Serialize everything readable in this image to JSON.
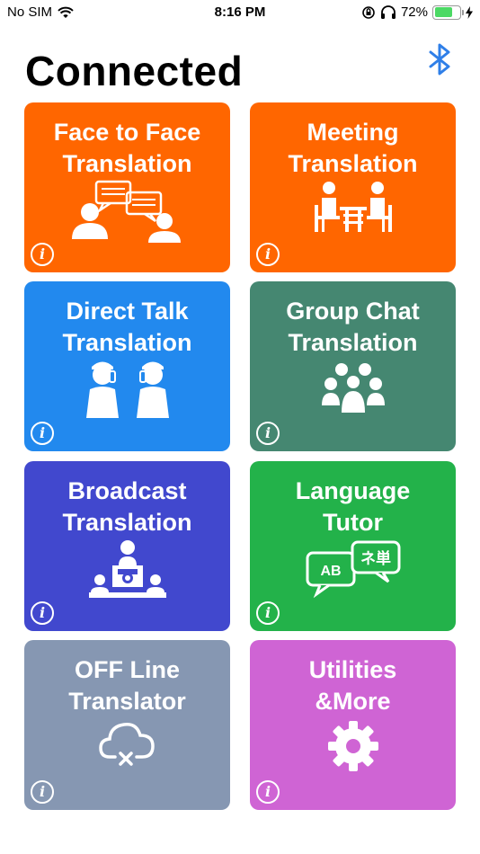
{
  "status_bar": {
    "carrier": "No SIM",
    "time": "8:16 PM",
    "battery_percent": "72%",
    "battery_level": 0.72
  },
  "header": {
    "title": "Connected",
    "bluetooth_icon": "bluetooth-icon"
  },
  "tiles": [
    {
      "id": "face-to-face",
      "line1": "Face to Face",
      "line2": "Translation",
      "color": "#FF6600",
      "icon": "face-to-face-icon"
    },
    {
      "id": "meeting",
      "line1": "Meeting",
      "line2": "Translation",
      "color": "#FF6600",
      "icon": "meeting-icon"
    },
    {
      "id": "direct-talk",
      "line1": "Direct Talk",
      "line2": "Translation",
      "color": "#2289EE",
      "icon": "direct-talk-icon"
    },
    {
      "id": "group-chat",
      "line1": "Group Chat",
      "line2": "Translation",
      "color": "#458771",
      "icon": "group-chat-icon"
    },
    {
      "id": "broadcast",
      "line1": "Broadcast",
      "line2": "Translation",
      "color": "#4148CE",
      "icon": "broadcast-icon"
    },
    {
      "id": "language-tutor",
      "line1": "Language",
      "line2": "Tutor",
      "color": "#23B24A",
      "icon": "language-tutor-icon",
      "bubble_left": "AB",
      "bubble_right": "ネ単"
    },
    {
      "id": "offline",
      "line1": "OFF Line",
      "line2": "Translator",
      "color": "#8697B2",
      "icon": "cloud-offline-icon"
    },
    {
      "id": "utilities",
      "line1": "Utilities",
      "line2": "&More",
      "color": "#CF64D4",
      "icon": "gear-icon"
    }
  ],
  "info_symbol": "i",
  "colors": {
    "accent": "#2F7FE8"
  }
}
